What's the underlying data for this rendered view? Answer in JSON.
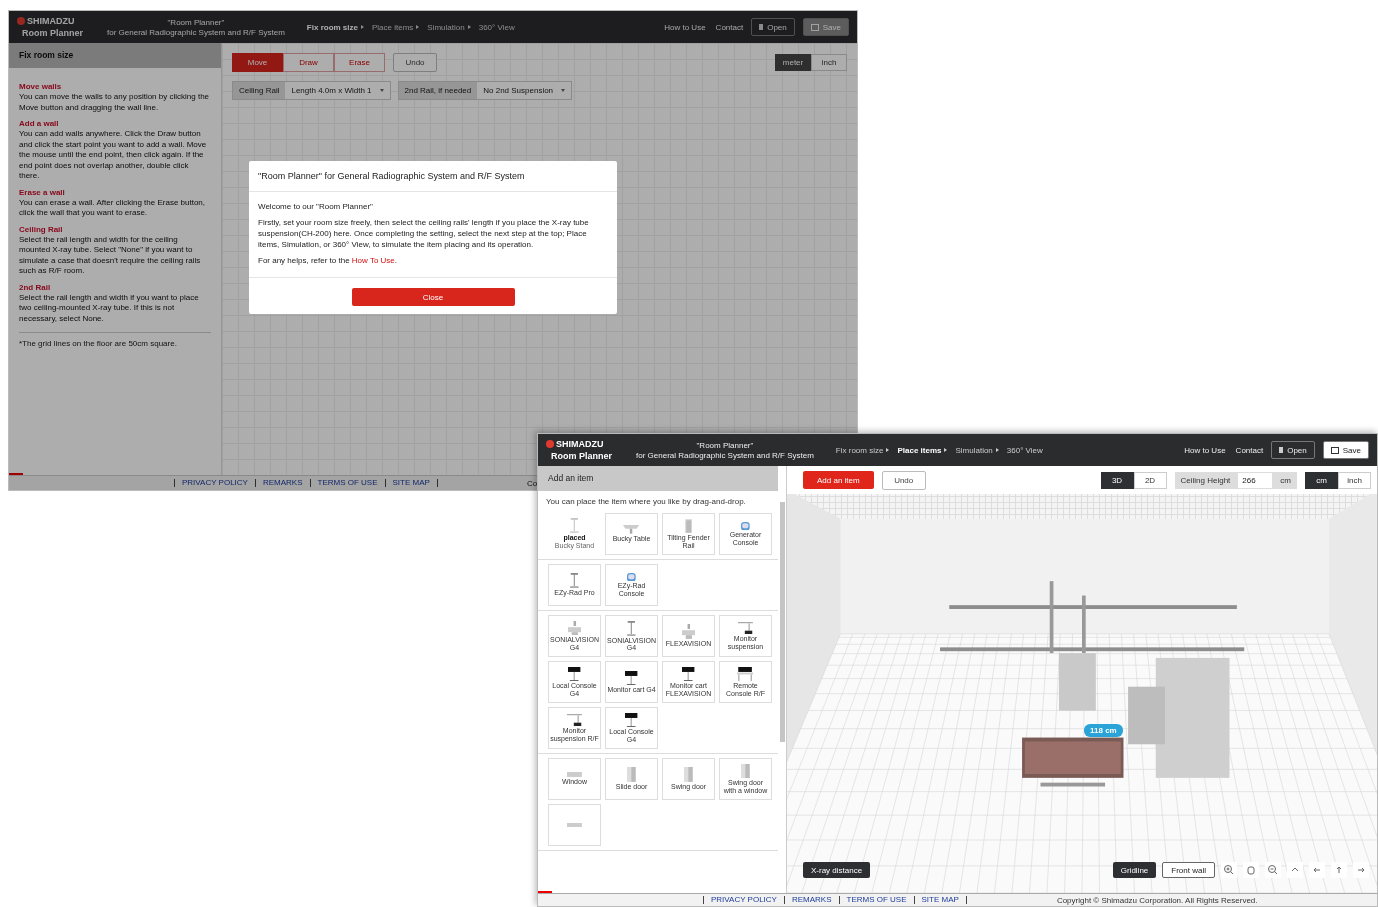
{
  "fix_window": {
    "header": {
      "brand": "SHIMADZU",
      "product": "Room Planner",
      "tagline": "\"Room Planner\"",
      "subtitle": "for General Radiographic System and R/F System"
    },
    "steps": [
      {
        "label": "Fix room size",
        "selected": true
      },
      {
        "label": "Place items",
        "selected": false
      },
      {
        "label": "Simulation",
        "selected": false
      },
      {
        "label": "360° View",
        "selected": false
      }
    ],
    "links": [
      "How to Use",
      "Contact"
    ],
    "buttons": [
      "Open",
      "Save"
    ],
    "sidebar": {
      "title": "Fix room size",
      "sections": [
        {
          "heading": "Move walls",
          "text": "You can move the walls to any position by clicking the Move button and dragging the wall line."
        },
        {
          "heading": "Add a wall",
          "text": "You can add walls anywhere. Click the Draw button and click the start point you want to add a wall. Move the mouse until the end point, then click again. If the end point does not overlap another, double click there."
        },
        {
          "heading": "Erase a wall",
          "text": "You can erase a wall. After clicking the Erase button, click the wall that you want to erase."
        },
        {
          "heading": "Ceiling Rail",
          "text": "Select the rail length and width for the ceiling mounted X-ray tube. Select \"None\" if you want to simulate a case that doesn't require the ceiling rails such as R/F room."
        },
        {
          "heading": "2nd Rail",
          "text": "Select the rail length and width if you want to place two ceiling-mounted X-ray tube. If this is not necessary, select None."
        }
      ],
      "note": "*The grid lines on the floor are 50cm square."
    },
    "tools": [
      {
        "label": "Move",
        "selected": true
      },
      {
        "label": "Draw",
        "selected": false
      },
      {
        "label": "Erase",
        "selected": false
      }
    ],
    "undo": "Undo",
    "units": [
      {
        "label": "meter",
        "selected": true
      },
      {
        "label": "inch",
        "selected": false
      }
    ],
    "selects": [
      {
        "label": "Ceiling Rail",
        "value": "Length 4.0m x Width 1"
      },
      {
        "label": "2nd Rail, if needed",
        "value": "No 2nd Suspension"
      }
    ],
    "footer_links": [
      "PRIVACY POLICY",
      "REMARKS",
      "TERMS OF USE",
      "SITE MAP"
    ],
    "copyright": "Co",
    "dialog": {
      "title": "\"Room Planner\" for General Radiographic System and R/F System",
      "welcome": "Welcome to our \"Room Planner\"",
      "body": "Firstly, set your room size freely, then select the ceiling rails' length if you place the X-ray tube suspension(CH-200) here. Once completing the setting, select the next step at the top; Place items, Simulation, or 360° View, to simulate the item placing and its operation.",
      "help_prefix": "For any helps, refer to the ",
      "help_link": "How To Use",
      "help_suffix": ".",
      "button": "Close"
    }
  },
  "place_window": {
    "header": {
      "brand": "SHIMADZU",
      "product": "Room Planner",
      "tagline": "\"Room Planner\"",
      "subtitle": "for General Radiographic System and R/F System"
    },
    "steps": [
      {
        "label": "Fix room size",
        "selected": false
      },
      {
        "label": "Place items",
        "selected": true
      },
      {
        "label": "Simulation",
        "selected": false
      },
      {
        "label": "360° View",
        "selected": false
      }
    ],
    "links": [
      "How to Use",
      "Contact"
    ],
    "buttons": [
      "Open",
      "Save"
    ],
    "sidebar": {
      "title": "Add an item",
      "hint": "You can place the item where you like by drag-and-drop.",
      "groups": [
        [
          {
            "kind": "stand",
            "label": "Bucky Stand",
            "badge": "placed"
          },
          {
            "kind": "table",
            "label": "Bucky Table"
          },
          {
            "kind": "rail",
            "label": "Tilting Fender Rail"
          },
          {
            "kind": "console",
            "label": "Generator Console"
          }
        ],
        [
          {
            "kind": "stand",
            "label": "EZy-Rad Pro"
          },
          {
            "kind": "console",
            "label": "EZy-Rad Console"
          }
        ],
        [
          {
            "kind": "rftable",
            "label": "SONIALVISION G4"
          },
          {
            "kind": "stand",
            "label": "SONIALVISION G4"
          },
          {
            "kind": "rftable",
            "label": "FLEXAVISION"
          },
          {
            "kind": "suspension",
            "label": "Monitor suspension"
          },
          {
            "kind": "cart",
            "label": "Local Console G4"
          },
          {
            "kind": "cart",
            "label": "Monitor cart G4"
          },
          {
            "kind": "cart",
            "label": "Monitor cart FLEXAVISION"
          },
          {
            "kind": "remote",
            "label": "Remote Console R/F"
          },
          {
            "kind": "suspension",
            "label": "Monitor suspension R/F"
          },
          {
            "kind": "cart",
            "label": "Local Console G4"
          }
        ],
        [
          {
            "kind": "window",
            "label": "Window"
          },
          {
            "kind": "door",
            "label": "Slide door"
          },
          {
            "kind": "door",
            "label": "Swing door"
          },
          {
            "kind": "door",
            "label": "Swing door with a window"
          },
          {
            "kind": "window"
          }
        ]
      ]
    },
    "add_button": "Add an item",
    "undo": "Undo",
    "views": [
      {
        "label": "3D",
        "selected": true
      },
      {
        "label": "2D",
        "selected": false
      }
    ],
    "ceiling": {
      "label": "Ceiling Height",
      "value": "266",
      "unit": "cm"
    },
    "units": [
      {
        "label": "cm",
        "selected": true
      },
      {
        "label": "inch",
        "selected": false
      }
    ],
    "measure": "118 cm",
    "xray_button": "X-ray distance",
    "gridline_button": "Gridline",
    "frontwall_button": "Front wall",
    "footer_links": [
      "PRIVACY POLICY",
      "REMARKS",
      "TERMS OF USE",
      "SITE MAP"
    ],
    "copyright": "Copyright © Shimadzu Corporation. All Rights Reserved."
  }
}
